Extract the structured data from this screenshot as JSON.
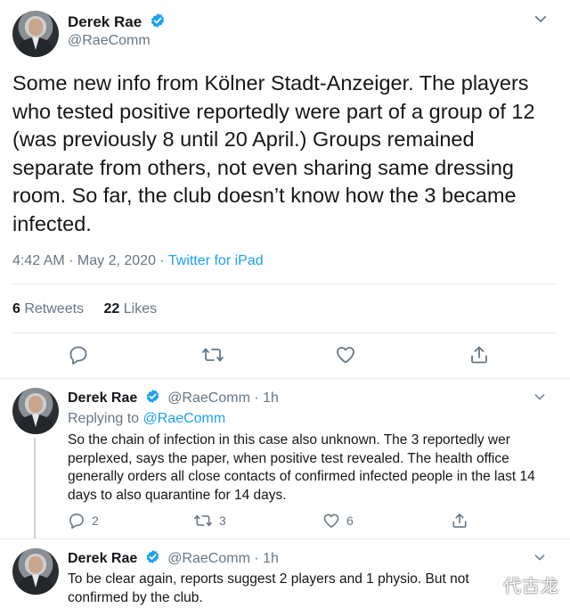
{
  "main": {
    "author": {
      "name": "Derek Rae",
      "handle": "@RaeComm"
    },
    "text": "Some new info from Kölner Stadt-Anzeiger. The players who tested positive reportedly were part of a group of 12 (was previously 8 until 20 April.) Groups remained separate from others, not even sharing same dressing room. So far, the club doesn’t know how the 3 became infected.",
    "time": "4:42 AM · May 2, 2020 · ",
    "source": "Twitter for iPad",
    "retweets_count": "6",
    "retweets_label": " Retweets",
    "likes_count": "22",
    "likes_label": " Likes"
  },
  "replies": [
    {
      "name": "Derek Rae",
      "handle_time": "@RaeComm · 1h",
      "replying_prefix": "Replying to ",
      "replying_to": "@RaeComm",
      "text": "So the chain of infection in this case also unknown. The 3 reportedly wer perplexed, says the paper, when positive test revealed. The health office generally orders all close contacts of confirmed infected people in the last 14 days to also quarantine for 14 days.",
      "reply_count": "2",
      "retweet_count": "3",
      "like_count": "6"
    },
    {
      "name": "Derek Rae",
      "handle_time": "@RaeComm · 1h",
      "text": "To be clear again, reports suggest 2 players and 1 physio. But not confirmed by the club."
    }
  ],
  "watermark": "代古龙",
  "colors": {
    "link": "#1da1f2",
    "muted": "#657786",
    "divider": "#e6ecf0",
    "text": "#14171a"
  },
  "icons": [
    "verified-badge-icon",
    "chevron-down-icon",
    "reply-icon",
    "retweet-icon",
    "like-icon",
    "share-icon"
  ]
}
